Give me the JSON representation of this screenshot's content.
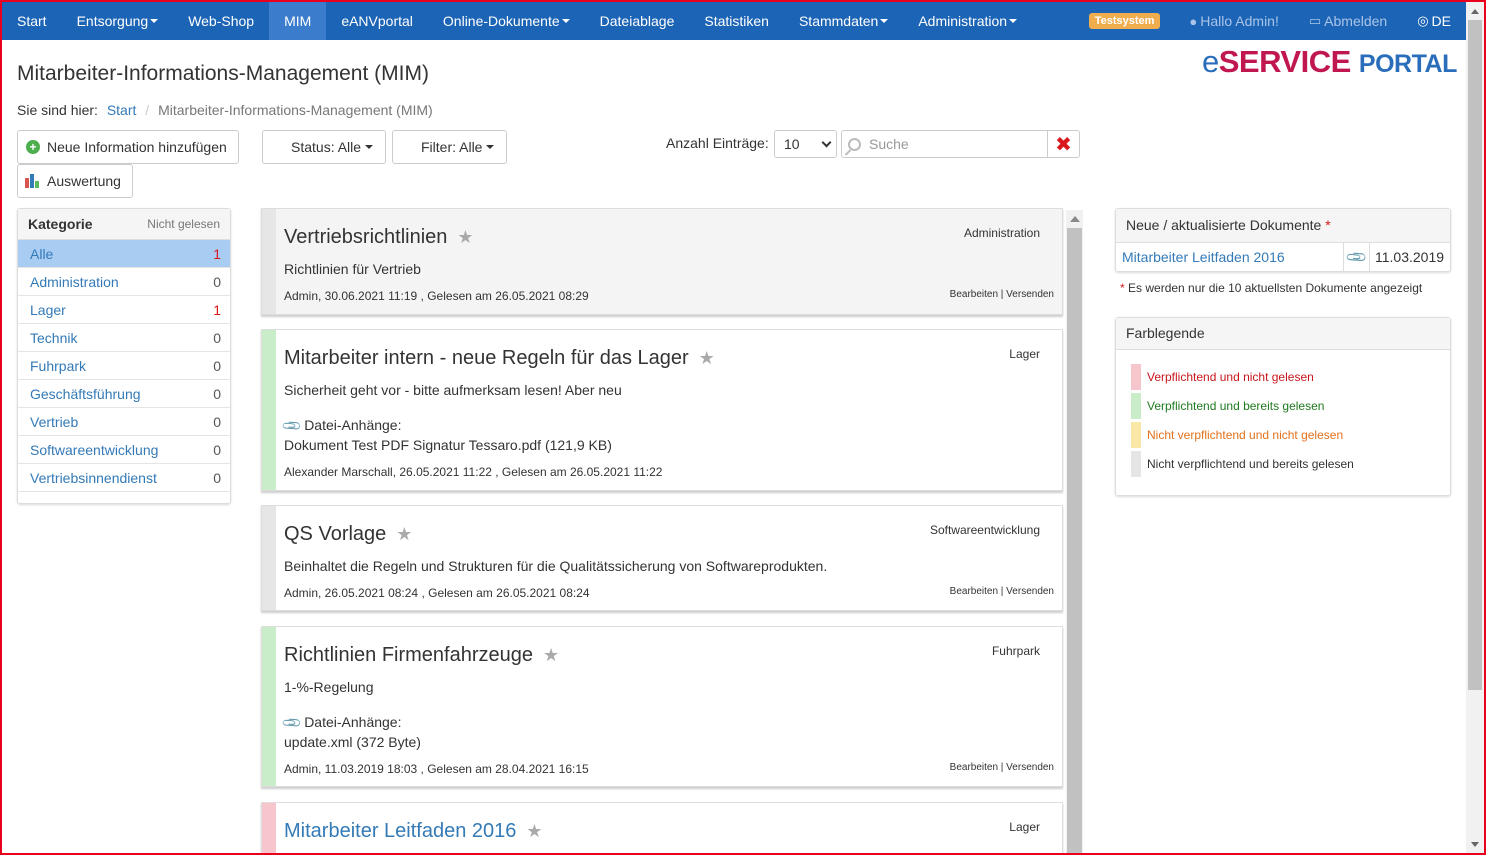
{
  "nav": {
    "items": [
      {
        "label": "Start",
        "dropdown": false
      },
      {
        "label": "Entsorgung",
        "dropdown": true
      },
      {
        "label": "Web-Shop",
        "dropdown": false
      },
      {
        "label": "MIM",
        "dropdown": false,
        "active": true
      },
      {
        "label": "eANVportal",
        "dropdown": false
      },
      {
        "label": "Online-Dokumente",
        "dropdown": true
      },
      {
        "label": "Dateiablage",
        "dropdown": false
      },
      {
        "label": "Statistiken",
        "dropdown": false
      },
      {
        "label": "Stammdaten",
        "dropdown": true
      },
      {
        "label": "Administration",
        "dropdown": true
      }
    ],
    "test_badge": "Testsystem",
    "user": "Hallo Admin!",
    "logout": "Abmelden",
    "language": "DE"
  },
  "page": {
    "title": "Mitarbeiter-Informations-Management (MIM)",
    "logo_e": "e",
    "logo_service": "SERVICE",
    "logo_portal": "PORTAL"
  },
  "breadcrumb": {
    "prefix": "Sie sind hier:",
    "home": "Start",
    "current": "Mitarbeiter-Informations-Management (MIM)"
  },
  "toolbar": {
    "add_label": "Neue Information hinzufügen",
    "report_label": "Auswertung",
    "status_label": "Status: Alle",
    "filter_label": "Filter: Alle",
    "count_label": "Anzahl Einträge:",
    "count_value": "10",
    "search_placeholder": "Suche"
  },
  "categories": {
    "header": "Kategorie",
    "header_unread": "Nicht gelesen",
    "items": [
      {
        "label": "Alle",
        "count": "1"
      },
      {
        "label": "Administration",
        "count": "0"
      },
      {
        "label": "Lager",
        "count": "1"
      },
      {
        "label": "Technik",
        "count": "0"
      },
      {
        "label": "Fuhrpark",
        "count": "0"
      },
      {
        "label": "Geschäftsführung",
        "count": "0"
      },
      {
        "label": "Vertrieb",
        "count": "0"
      },
      {
        "label": "Softwareentwicklung",
        "count": "0"
      },
      {
        "label": "Vertriebsinnendienst",
        "count": "0"
      }
    ]
  },
  "cards": [
    {
      "title": "Vertriebsrichtlinien",
      "category": "Administration",
      "description": "Richtlinien für Vertrieb",
      "meta": "Admin, 30.06.2021 11:19 , Gelesen am 26.05.2021 08:29",
      "actions": "Bearbeiten | Versenden"
    },
    {
      "title": "Mitarbeiter intern - neue Regeln für das Lager",
      "category": "Lager",
      "description": "Sicherheit geht vor - bitte aufmerksam lesen! Aber neu",
      "attachments_label": "Datei-Anhänge:",
      "attachment": "Dokument Test PDF Signatur Tessaro.pdf (121,9 KB)",
      "meta": "Alexander Marschall, 26.05.2021 11:22 , Gelesen am 26.05.2021 11:22"
    },
    {
      "title": "QS Vorlage",
      "category": "Softwareentwicklung",
      "description": "Beinhaltet die Regeln und Strukturen für die Qualitätssicherung von Softwareprodukten.",
      "meta": "Admin, 26.05.2021 08:24 , Gelesen am 26.05.2021 08:24",
      "actions": "Bearbeiten | Versenden"
    },
    {
      "title": "Richtlinien Firmenfahrzeuge",
      "category": "Fuhrpark",
      "description": "1-%-Regelung",
      "attachments_label": "Datei-Anhänge:",
      "attachment": "update.xml (372 Byte)",
      "meta": "Admin, 11.03.2019 18:03 , Gelesen am 28.04.2021 16:15",
      "actions": "Bearbeiten | Versenden"
    },
    {
      "title": "Mitarbeiter Leitfaden 2016",
      "category": "Lager"
    }
  ],
  "documents": {
    "header": "Neue / aktualisierte Dokumente",
    "required_mark": "*",
    "items": [
      {
        "name": "Mitarbeiter Leitfaden 2016",
        "date": "11.03.2019"
      }
    ],
    "note_mark": "*",
    "note": "Es werden nur die 10 aktuellsten Dokumente angezeigt"
  },
  "legend": {
    "header": "Farblegende",
    "items": [
      {
        "label": "Verpflichtend und nicht gelesen",
        "swatch": "#f7c6cc",
        "text_color": "#c9161c"
      },
      {
        "label": "Verpflichtend und bereits gelesen",
        "swatch": "#c9ecc9",
        "text_color": "#1f7a1f"
      },
      {
        "label": "Nicht verpflichtend und nicht gelesen",
        "swatch": "#fbe7a6",
        "text_color": "#e2711d"
      },
      {
        "label": "Nicht verpflichtend und bereits gelesen",
        "swatch": "#e6e6e6",
        "text_color": "#333333"
      }
    ]
  },
  "colors": {
    "nav_bg": "#1c64b5",
    "link": "#337ab7",
    "unread_red": "#d9181e"
  }
}
